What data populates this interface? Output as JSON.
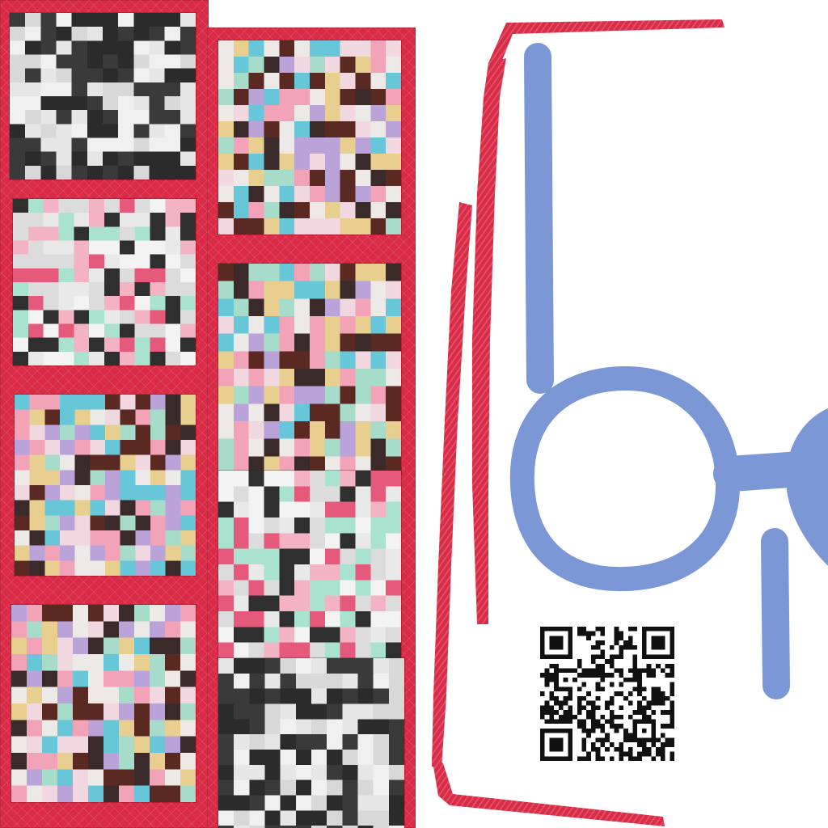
{
  "scene": {
    "description_free": true,
    "quilt": {
      "columns": [
        {
          "blocks": [
            {
              "palette": "mono"
            },
            {
              "palette": "pink"
            },
            {
              "palette": "multi"
            },
            {
              "palette": "multi"
            }
          ]
        },
        {
          "blocks": [
            {
              "palette": "multi"
            },
            {
              "palette": "multi"
            },
            {
              "palette": "pink"
            },
            {
              "palette": "mono"
            }
          ]
        }
      ],
      "palettes": {
        "mono": [
          "#2b2b2b",
          "#3a3a3a",
          "#e6e6e6",
          "#f0f0f0",
          "#d8d8d8"
        ],
        "pink": [
          "#f3f3f3",
          "#e9e9e9",
          "#f4b3c4",
          "#a9e3cf",
          "#2f2f2f",
          "#e55a7a",
          "#dcdcdc"
        ],
        "multi": [
          "#ece9e6",
          "#67c6d8",
          "#b9a3d9",
          "#5a2a22",
          "#e8cf8f",
          "#f2a3b8",
          "#a7dccb",
          "#3a2a2a",
          "#f0d7e0"
        ]
      }
    },
    "colors": {
      "binding": "#d92a46",
      "accent_blue": "#7b97d6",
      "qr_dark": "#111111",
      "qr_light": "#ffffff"
    }
  }
}
